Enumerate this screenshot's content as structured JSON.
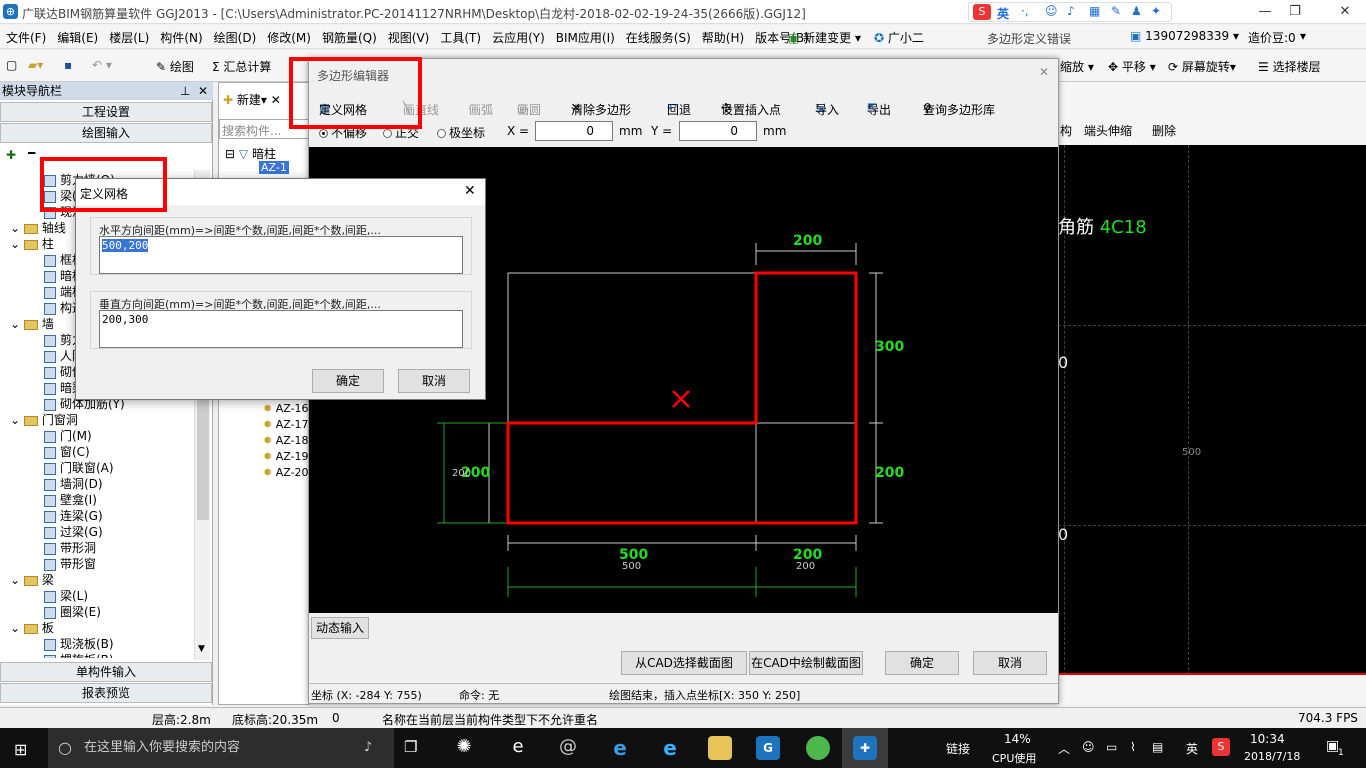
{
  "app": {
    "title": "广联达BIM钢筋算量软件 GGJ2013 - [C:\\Users\\Administrator.PC-20141127NRHM\\Desktop\\白龙村-2018-02-02-19-24-35(2666版).GGJ12]",
    "menu": [
      "文件(F)",
      "编辑(E)",
      "楼层(L)",
      "构件(N)",
      "绘图(D)",
      "修改(M)",
      "钢筋量(Q)",
      "视图(V)",
      "工具(T)",
      "云应用(Y)",
      "BIM应用(I)",
      "在线服务(S)",
      "帮助(H)",
      "版本号(B)"
    ],
    "new_change": "新建变更",
    "guangxiaoer": "广小二",
    "polygon_error": "多边形定义错误",
    "phone": "13907298339",
    "price_bean": "造价豆:0",
    "ime": "英"
  },
  "toolbar": {
    "draw": "绘图",
    "sum": "汇总计算",
    "zoom": "缩放",
    "pan": "平移",
    "rotate": "屏幕旋转",
    "select_floor": "选择楼层"
  },
  "nav": {
    "header": "模块导航栏",
    "project_settings": "工程设置",
    "draw_input": "绘图输入",
    "single_input": "单构件输入",
    "report_preview": "报表预览",
    "tree": [
      {
        "indent": 1,
        "label": "剪力墙(Q)",
        "type": "item"
      },
      {
        "indent": 1,
        "label": "梁(L)",
        "type": "item"
      },
      {
        "indent": 1,
        "label": "现浇板(B)",
        "type": "item"
      },
      {
        "indent": 0,
        "label": "轴线",
        "type": "folder"
      },
      {
        "indent": 0,
        "label": "柱",
        "type": "folder"
      },
      {
        "indent": 1,
        "label": "框柱(Z)",
        "type": "item"
      },
      {
        "indent": 1,
        "label": "暗柱(Z)",
        "type": "item"
      },
      {
        "indent": 1,
        "label": "端柱(Z)",
        "type": "item"
      },
      {
        "indent": 1,
        "label": "构造柱(Z)",
        "type": "item"
      },
      {
        "indent": 0,
        "label": "墙",
        "type": "folder"
      },
      {
        "indent": 1,
        "label": "剪力墙(Q)",
        "type": "item"
      },
      {
        "indent": 1,
        "label": "人防门框墙(RF)",
        "type": "item"
      },
      {
        "indent": 1,
        "label": "砌体墙(Q)",
        "type": "item"
      },
      {
        "indent": 1,
        "label": "暗梁(A)",
        "type": "item"
      },
      {
        "indent": 1,
        "label": "砌体加筋(Y)",
        "type": "item"
      },
      {
        "indent": 0,
        "label": "门窗洞",
        "type": "folder"
      },
      {
        "indent": 1,
        "label": "门(M)",
        "type": "item"
      },
      {
        "indent": 1,
        "label": "窗(C)",
        "type": "item"
      },
      {
        "indent": 1,
        "label": "门联窗(A)",
        "type": "item"
      },
      {
        "indent": 1,
        "label": "墙洞(D)",
        "type": "item"
      },
      {
        "indent": 1,
        "label": "壁龛(I)",
        "type": "item"
      },
      {
        "indent": 1,
        "label": "连梁(G)",
        "type": "item"
      },
      {
        "indent": 1,
        "label": "过梁(G)",
        "type": "item"
      },
      {
        "indent": 1,
        "label": "带形洞",
        "type": "item"
      },
      {
        "indent": 1,
        "label": "带形窗",
        "type": "item"
      },
      {
        "indent": 0,
        "label": "梁",
        "type": "folder"
      },
      {
        "indent": 1,
        "label": "梁(L)",
        "type": "item"
      },
      {
        "indent": 1,
        "label": "圈梁(E)",
        "type": "item"
      },
      {
        "indent": 0,
        "label": "板",
        "type": "folder"
      },
      {
        "indent": 1,
        "label": "现浇板(B)",
        "type": "item"
      },
      {
        "indent": 1,
        "label": "螺旋板(B)",
        "type": "item"
      }
    ]
  },
  "complist": {
    "new": "新建",
    "search_placeholder": "搜索构件...",
    "root": "暗柱",
    "items": [
      "AZ-1",
      "AZ-16",
      "AZ-17",
      "AZ-18",
      "AZ-19",
      "AZ-20"
    ]
  },
  "right": {
    "actions": [
      "构",
      "端头伸缩",
      "删除"
    ],
    "corner_label": "角筋",
    "corner_value": "4C18",
    "scale_label": "500",
    "side_label_1": "0",
    "side_label_2": "0"
  },
  "poly": {
    "title": "多边形编辑器",
    "tools": {
      "define_grid": "定义网格",
      "line": "画直线",
      "arc": "画弧",
      "circle": "画圆",
      "clear": "清除多边形",
      "undo": "回退",
      "insert_point": "设置插入点",
      "import": "导入",
      "export": "导出",
      "query_lib": "查询多边形库"
    },
    "mode": {
      "no_offset": "不偏移",
      "ortho": "正交",
      "polar": "极坐标",
      "x_label": "X =",
      "x_value": "0",
      "y_label": "Y =",
      "y_value": "0",
      "unit": "mm"
    },
    "dims": {
      "top": "200",
      "right_upper": "300",
      "right_lower": "200",
      "left_lower": "200",
      "left_lower_small": "200",
      "bottom_left": "500",
      "bottom_left_small": "500",
      "bottom_right": "200",
      "bottom_right_small": "200"
    },
    "dynamic_input": "动态输入",
    "buttons": {
      "from_cad": "从CAD选择截面图",
      "draw_cad": "在CAD中绘制截面图",
      "ok": "确定",
      "cancel": "取消"
    },
    "status": {
      "coord": "坐标 (X: -284 Y: 755)",
      "command": "命令: 无",
      "message": "绘图结束，插入点坐标[X: 350 Y: 250]"
    }
  },
  "grid_dialog": {
    "title": "定义网格",
    "h_label": "水平方向间距(mm)=>间距*个数,间距,间距*个数,间距,...",
    "h_value": "500,200",
    "v_label": "垂直方向间距(mm)=>间距*个数,间距,间距*个数,间距,...",
    "v_value": "200,300",
    "ok": "确定",
    "cancel": "取消"
  },
  "statusbar": {
    "floor_height": "层高:2.8m",
    "base_height": "底标高:20.35m",
    "zero": "0",
    "message": "名称在当前层当前构件类型下不允许重名",
    "fps": "704.3 FPS"
  },
  "taskbar": {
    "search_placeholder": "在这里输入你要搜索的内容",
    "link": "链接",
    "cpu_percent": "14%",
    "cpu_label": "CPU使用",
    "ime": "英",
    "time": "10:34",
    "date": "2018/7/18",
    "notif": "1"
  },
  "colors": {
    "red_highlight": "#ff0000",
    "dim_green": "#22dd22",
    "canvas_bg": "#000000"
  }
}
